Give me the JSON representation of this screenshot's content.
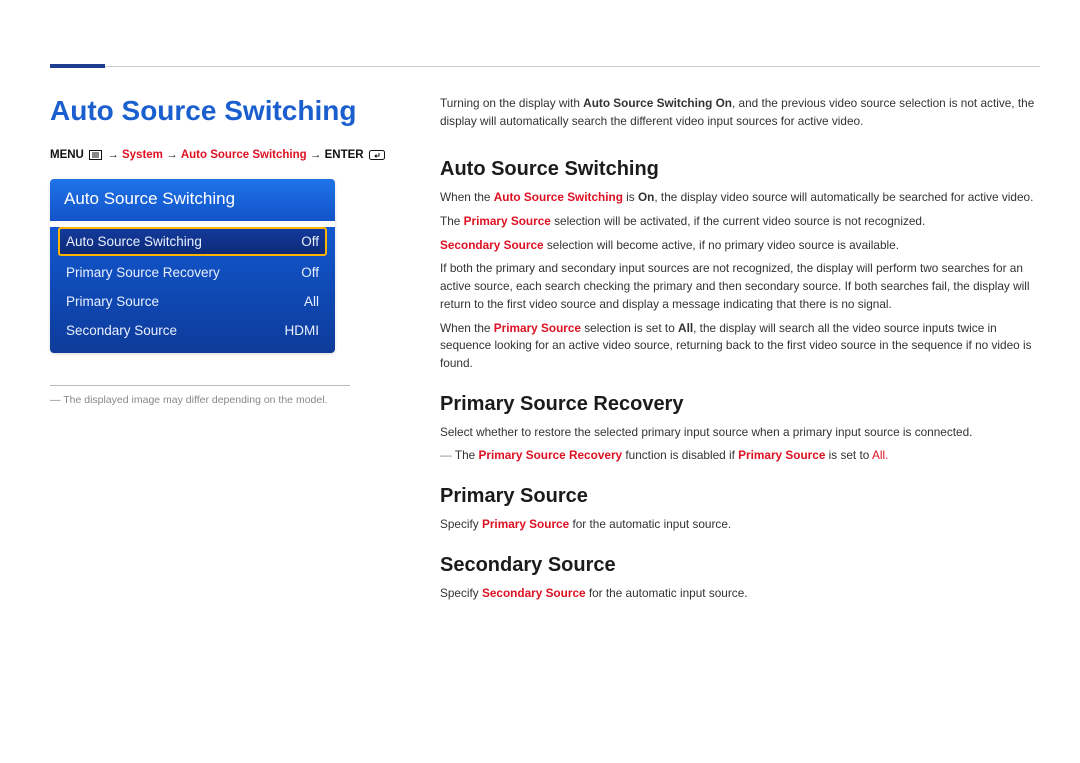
{
  "pageTitle": "Auto Source Switching",
  "breadcrumb": {
    "menu": "MENU",
    "arrow": "→",
    "system": "System",
    "item": "Auto Source Switching",
    "enter": "ENTER"
  },
  "osd": {
    "title": "Auto Source Switching",
    "rows": [
      {
        "label": "Auto Source Switching",
        "value": "Off",
        "selected": true
      },
      {
        "label": "Primary Source Recovery",
        "value": "Off",
        "selected": false
      },
      {
        "label": "Primary Source",
        "value": "All",
        "selected": false
      },
      {
        "label": "Secondary Source",
        "value": "HDMI",
        "selected": false
      }
    ]
  },
  "disclaimer": "The displayed image may differ depending on the model.",
  "intro": {
    "pre": "Turning on the display with ",
    "bold": "Auto Source Switching On",
    "post": ", and the previous video source selection is not active, the display will automatically search the different video input sources for active video."
  },
  "sections": {
    "ass": {
      "heading": "Auto Source Switching",
      "p1a": "When the ",
      "p1b": "Auto Source Switching",
      "p1c": " is ",
      "p1d": "On",
      "p1e": ", the display video source will automatically be searched for active video.",
      "p2a": "The ",
      "p2b": "Primary Source",
      "p2c": " selection will be activated, if the current video source is not recognized.",
      "p3a": "Secondary Source",
      "p3b": " selection will become active, if no primary video source is available.",
      "p4": "If both the primary and secondary input sources are not recognized, the display will perform two searches for an active source, each search checking the primary and then secondary source. If both searches fail, the display will return to the first video source and display a message indicating that there is no signal.",
      "p5a": "When the ",
      "p5b": "Primary Source",
      "p5c": " selection is set to ",
      "p5d": "All",
      "p5e": ", the display will search all the video source inputs twice in sequence looking for an active video source, returning back to the first video source in the sequence if no video is found."
    },
    "psr": {
      "heading": "Primary Source Recovery",
      "p1": "Select whether to restore the selected primary input source when a primary input source is connected.",
      "noteA": "The ",
      "noteB": "Primary Source Recovery",
      "noteC": " function is disabled if ",
      "noteD": "Primary Source",
      "noteE": " is set to ",
      "noteF": "All",
      "noteG": "."
    },
    "ps": {
      "heading": "Primary Source",
      "p1a": "Specify ",
      "p1b": "Primary Source",
      "p1c": " for the automatic input source."
    },
    "ss": {
      "heading": "Secondary Source",
      "p1a": "Specify ",
      "p1b": "Secondary Source",
      "p1c": " for the automatic input source."
    }
  }
}
